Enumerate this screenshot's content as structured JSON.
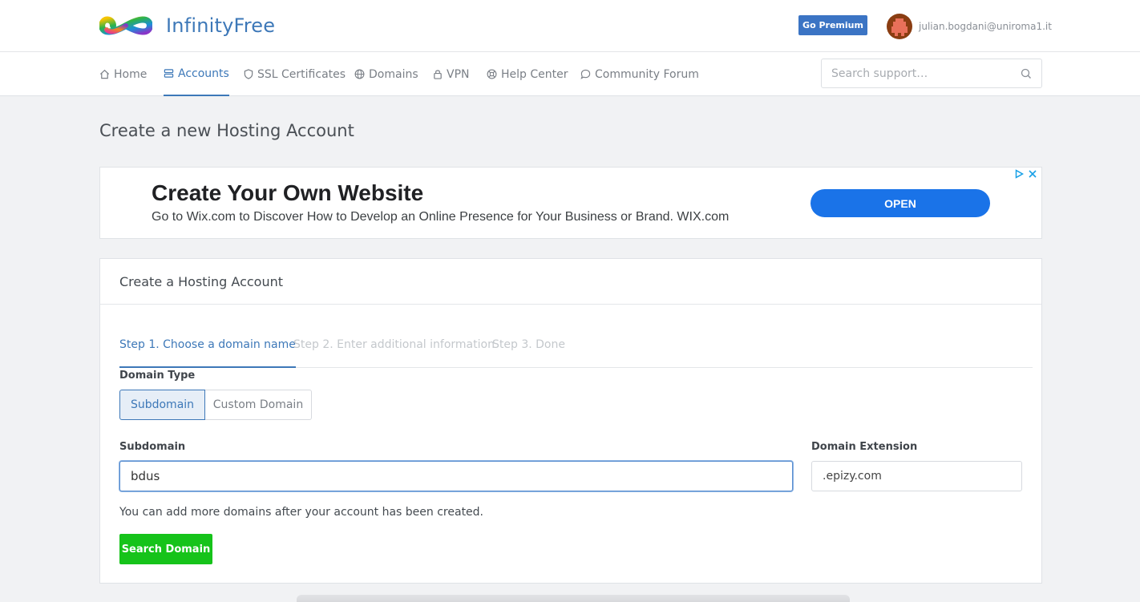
{
  "header": {
    "brand": "InfinityFree",
    "premium_label": "Go Premium",
    "user_email": "julian.bogdani@uniroma1.it"
  },
  "nav": {
    "items": [
      {
        "label": "Home",
        "icon": "home-icon"
      },
      {
        "label": "Accounts",
        "icon": "server-icon",
        "active": true
      },
      {
        "label": "SSL Certificates",
        "icon": "shield-icon"
      },
      {
        "label": "Domains",
        "icon": "globe-icon"
      },
      {
        "label": "VPN",
        "icon": "lock-icon"
      },
      {
        "label": "Help Center",
        "icon": "lifebuoy-icon"
      },
      {
        "label": "Community Forum",
        "icon": "chat-bubble-icon"
      }
    ],
    "search_placeholder": "Search support…"
  },
  "page": {
    "title": "Create a new Hosting Account"
  },
  "ad": {
    "title": "Create Your Own Website",
    "description": "Go to Wix.com to Discover How to Develop an Online Presence for Your Business or Brand. WIX.com",
    "button": "OPEN"
  },
  "card": {
    "title": "Create a Hosting Account",
    "steps": [
      {
        "label": "Step 1. Choose a domain name",
        "active": true
      },
      {
        "label": "Step 2. Enter additional information",
        "active": false
      },
      {
        "label": "Step 3. Done",
        "active": false
      }
    ],
    "domain_type_label": "Domain Type",
    "domain_type_options": [
      "Subdomain",
      "Custom Domain"
    ],
    "domain_type_selected": "Subdomain",
    "subdomain_label": "Subdomain",
    "subdomain_value": "bdus",
    "extension_label": "Domain Extension",
    "extension_value": ".epizy.com",
    "hint": "You can add more domains after your account has been created.",
    "search_button": "Search Domain"
  },
  "colors": {
    "accent": "#3d78b8",
    "premium": "#3b74c4",
    "success": "#16c31a",
    "ad_button": "#1a73e8"
  }
}
